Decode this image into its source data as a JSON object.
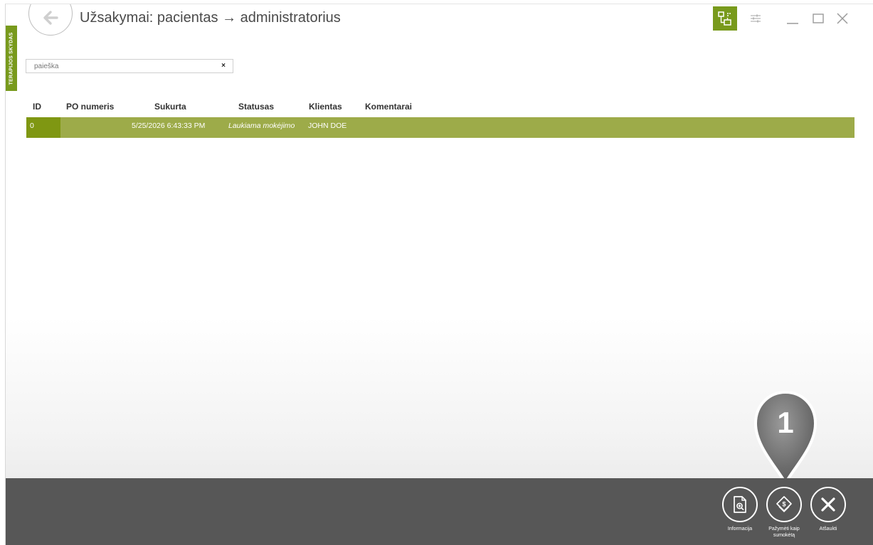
{
  "app": {
    "side_tab_label": "TERAPIJOS SKYDAS",
    "title": "Užsakymai: pacientas → administratorius"
  },
  "search": {
    "placeholder": "paieška",
    "clear_glyph": "×"
  },
  "table": {
    "columns": [
      "ID",
      "PO numeris",
      "Sukurta",
      "Statusas",
      "Klientas",
      "Komentarai"
    ],
    "rows": [
      {
        "id": "0",
        "po_number": "",
        "created": "5/25/2026 6:43:33 PM",
        "status": "Laukiama mokėjimo",
        "client": "JOHN DOE",
        "comments": ""
      }
    ]
  },
  "actions": {
    "info_label": "Informacija",
    "mark_paid_label_line1": "Pažymėti kaip",
    "mark_paid_label_line2": "sumokėtą",
    "cancel_label": "Atšaukti"
  },
  "callout": {
    "number": "1"
  },
  "colors": {
    "accent": "#789a1c",
    "row_highlight": "#9dab49",
    "row_id_cell": "#7f9712",
    "bottom_bar": "#575757"
  },
  "icons": {
    "back": "arrow-left-icon",
    "network": "network-icon",
    "settings": "sliders-icon",
    "minimize": "minimize-icon",
    "maximize": "maximize-icon",
    "close": "close-icon",
    "info": "document-search-icon",
    "mark_paid": "money-tag-icon",
    "cancel": "x-icon"
  }
}
